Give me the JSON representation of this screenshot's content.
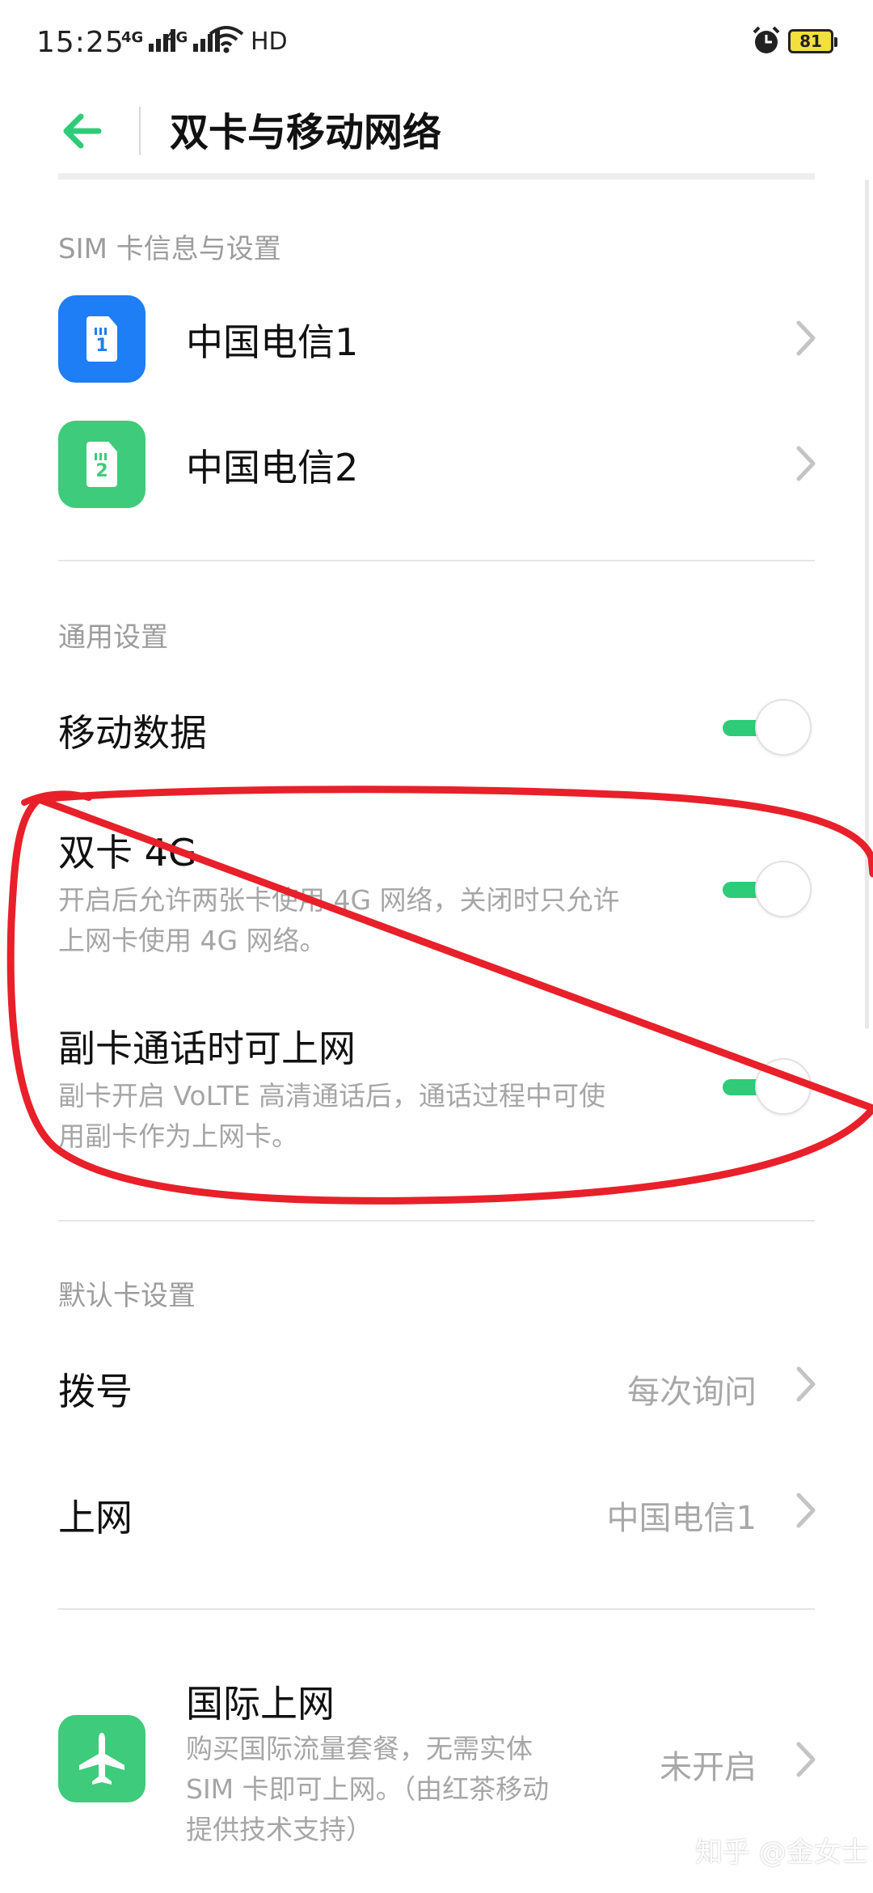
{
  "status_bar": {
    "time": "15:25",
    "signal1": "4G",
    "signal2": "4G",
    "hd": "HD",
    "battery": "81"
  },
  "header": {
    "title": "双卡与移动网络"
  },
  "sim_section": {
    "label": "SIM 卡信息与设置",
    "sims": [
      {
        "name": "中国电信1",
        "number": "1",
        "color": "#1d7ef5"
      },
      {
        "name": "中国电信2",
        "number": "2",
        "color": "#3ecb7b"
      }
    ]
  },
  "general": {
    "label": "通用设置",
    "mobile_data": {
      "title": "移动数据",
      "enabled": true
    },
    "dual_4g": {
      "title": "双卡 4G",
      "desc_line1": "开启后允许两张卡使用 4G 网络，关闭时只允许",
      "desc_line2": "上网卡使用 4G 网络。",
      "enabled": true
    },
    "secondary_data": {
      "title": "副卡通话时可上网",
      "desc_line1": "副卡开启 VoLTE 高清通话后，通话过程中可使",
      "desc_line2": "用副卡作为上网卡。",
      "enabled": true
    }
  },
  "default_card": {
    "label": "默认卡设置",
    "dial": {
      "title": "拨号",
      "value": "每次询问"
    },
    "internet": {
      "title": "上网",
      "value": "中国电信1"
    }
  },
  "roaming": {
    "title": "国际上网",
    "desc_line1": "购买国际流量套餐，无需实体",
    "desc_line2": "SIM 卡即可上网。（由红茶移动",
    "desc_line3": "提供技术支持）",
    "value": "未开启"
  },
  "watermark": "知乎 @金女士",
  "colors": {
    "accent": "#2ecb78",
    "sim1": "#1d7ef5",
    "sim2": "#3ecb7b",
    "annotation": "#e8202a"
  }
}
